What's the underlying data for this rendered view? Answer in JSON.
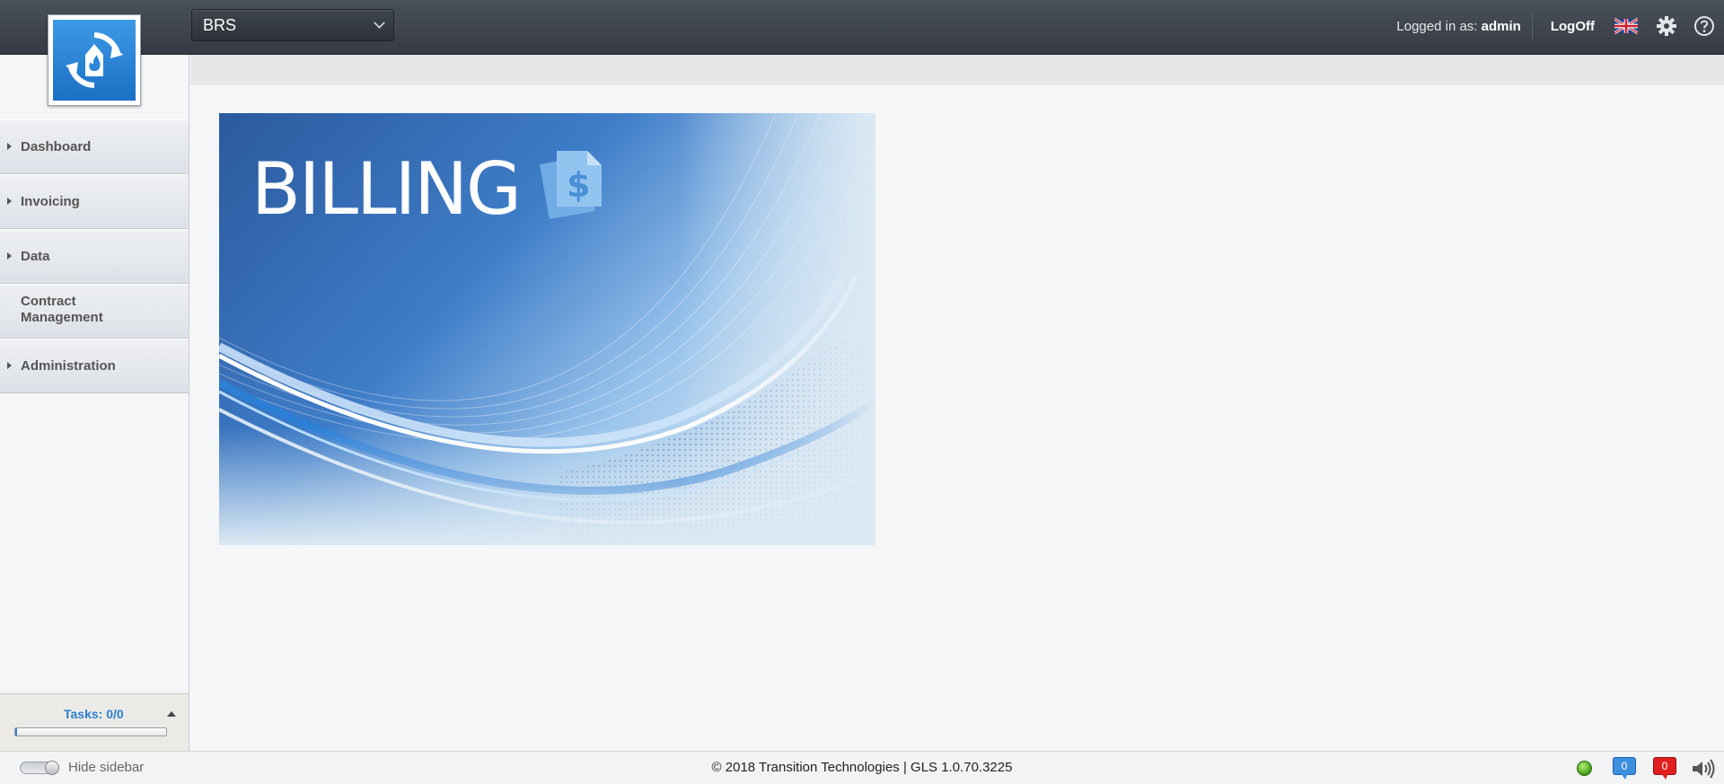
{
  "header": {
    "app_selector": "BRS",
    "logged_in_prefix": "Logged in as:",
    "username": "admin",
    "logoff_label": "LogOff"
  },
  "sidebar": {
    "items": [
      {
        "label": "Dashboard",
        "expandable": true
      },
      {
        "label": "Invoicing",
        "expandable": true
      },
      {
        "label": "Data",
        "expandable": true
      },
      {
        "label_line1": "Contract",
        "label_line2": "Management",
        "expandable": false
      },
      {
        "label": "Administration",
        "expandable": true
      }
    ],
    "tasks_label": "Tasks: 0/0",
    "tasks_progress": 0
  },
  "banner": {
    "title": "BILLING",
    "icon_symbol": "$"
  },
  "footer": {
    "hide_sidebar_label": "Hide sidebar",
    "copyright": "© 2018 Transition Technologies | GLS 1.0.70.3225",
    "messages_count": "0",
    "alerts_count": "0"
  },
  "colors": {
    "topbar": "#3f444c",
    "accent_blue": "#2a7fcf",
    "status_green": "#5cc01f",
    "alert_red": "#e02020"
  }
}
